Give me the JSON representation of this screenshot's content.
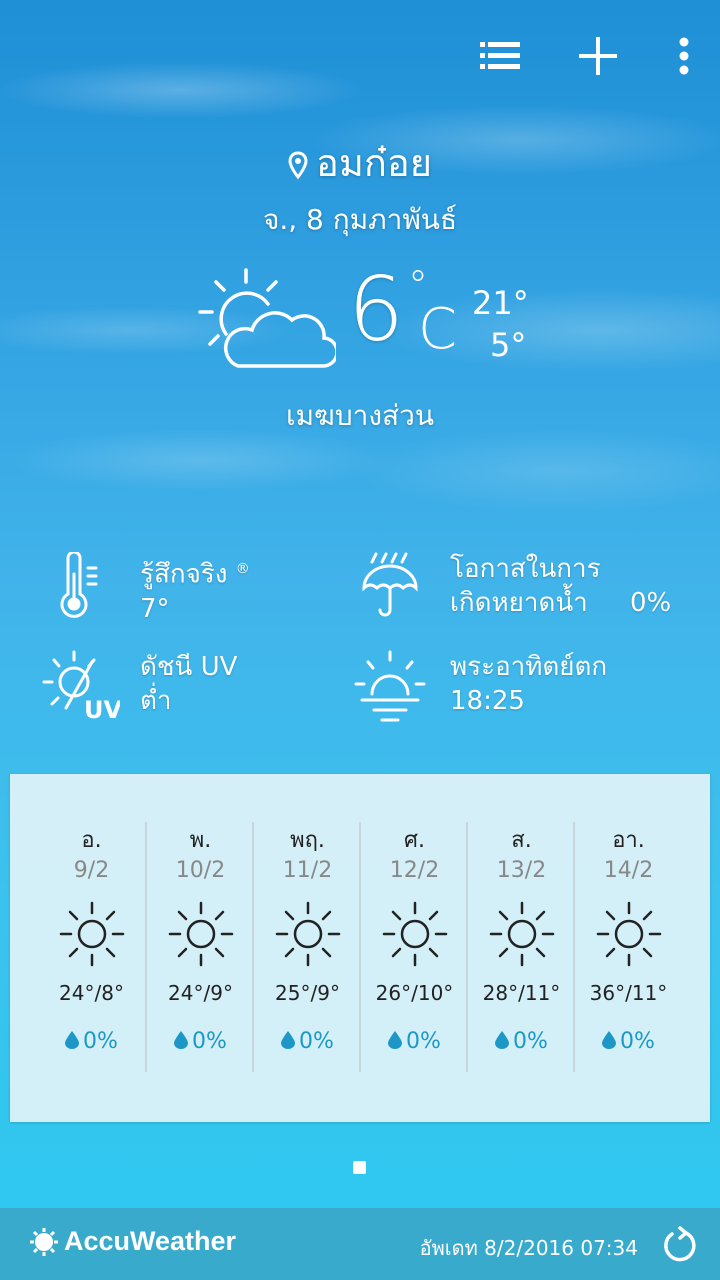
{
  "location": "อมก๋อย",
  "date": "จ., 8 กุมภาพันธ์",
  "current": {
    "temp": "6",
    "unit_deg": "°",
    "unit": "C",
    "high": "21°",
    "low": "5°",
    "condition": "เมฆบางส่วน",
    "icon": "partly-cloudy-icon"
  },
  "details": {
    "realfeel_label": "รู้สึกจริง",
    "realfeel_mark": "®",
    "realfeel_value": "7°",
    "precip_label_1": "โอกาสในการ",
    "precip_label_2": "เกิดหยาดน้ำ",
    "precip_value": "0%",
    "uv_label": "ดัชนี UV",
    "uv_value": "ต่ำ",
    "uv_icon_text": "UV",
    "sunset_label": "พระอาทิตย์ตก",
    "sunset_value": "18:25"
  },
  "forecast": [
    {
      "day": "อ.",
      "date": "9/2",
      "range": "24°/8°",
      "rain": "0%"
    },
    {
      "day": "พ.",
      "date": "10/2",
      "range": "24°/9°",
      "rain": "0%"
    },
    {
      "day": "พฤ.",
      "date": "11/2",
      "range": "25°/9°",
      "rain": "0%"
    },
    {
      "day": "ศ.",
      "date": "12/2",
      "range": "26°/10°",
      "rain": "0%"
    },
    {
      "day": "ส.",
      "date": "13/2",
      "range": "28°/11°",
      "rain": "0%"
    },
    {
      "day": "อา.",
      "date": "14/2",
      "range": "36°/11°",
      "rain": "0%"
    }
  ],
  "footer": {
    "brand": "AccuWeather",
    "updated": "อัพเดท 8/2/2016 07:34"
  },
  "icons": {
    "list": "list-icon",
    "add": "plus-icon",
    "more": "more-vert-icon",
    "refresh": "refresh-icon"
  },
  "colors": {
    "rain_accent": "#1d98c6",
    "footer_bg": "#3ba4c6"
  }
}
